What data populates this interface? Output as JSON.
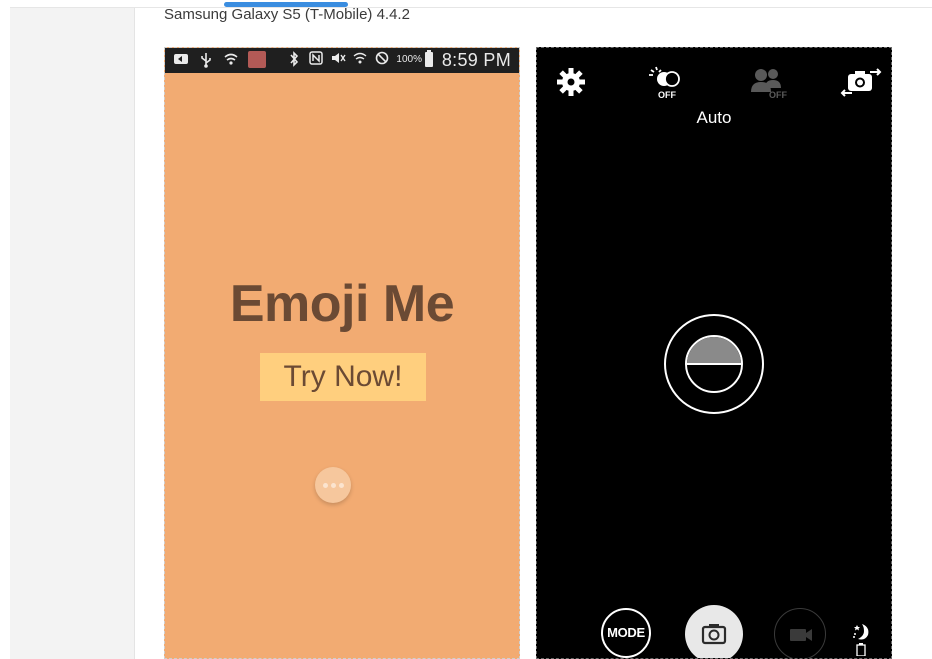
{
  "page": {
    "caption": "Samsung Galaxy S5 (T-Mobile) 4.4.2"
  },
  "status_bar": {
    "battery_percent": "100%",
    "time": "8:59 PM",
    "icons_left": [
      "notification-icon",
      "usb-icon",
      "wifi-icon",
      "app-badge-icon"
    ],
    "icons_right": [
      "bluetooth-icon",
      "nfc-icon",
      "mute-icon",
      "wifi-signal-icon",
      "no-signal-icon",
      "battery-icon"
    ]
  },
  "app_screen": {
    "title": "Emoji Me",
    "cta_label": "Try Now!",
    "background_color": "#f2ab72",
    "title_color": "#6b4a34",
    "cta_color": "#ffcf7e"
  },
  "camera_screen": {
    "flash_state": "OFF",
    "face_state": "OFF",
    "scene_mode": "Auto",
    "mode_label": "MODE",
    "icons": [
      "gear-icon",
      "flash-icon",
      "face-detect-icon",
      "switch-camera-icon",
      "camera-icon",
      "video-icon",
      "night-mode-icon"
    ]
  }
}
